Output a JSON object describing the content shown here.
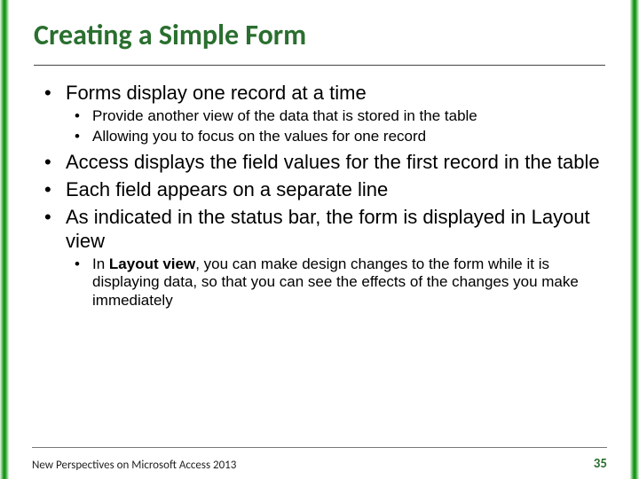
{
  "title": "Creating a Simple Form",
  "bullets": {
    "b1": "Forms display one record at a time",
    "b1a": "Provide another view of the data that is stored in the table",
    "b1b": "Allowing you to focus on the values for one record",
    "b2": "Access displays the field values for the first record in the table",
    "b3": "Each field appears on a separate line",
    "b4": "As indicated in the status bar, the form is displayed in Layout view",
    "b4a_prefix": "In ",
    "b4a_bold": "Layout view",
    "b4a_rest": ", you can make design changes to the form while it is displaying data, so that you can see the effects of the changes you make immediately"
  },
  "footer": {
    "text": "New Perspectives on Microsoft Access 2013",
    "page": "35"
  }
}
